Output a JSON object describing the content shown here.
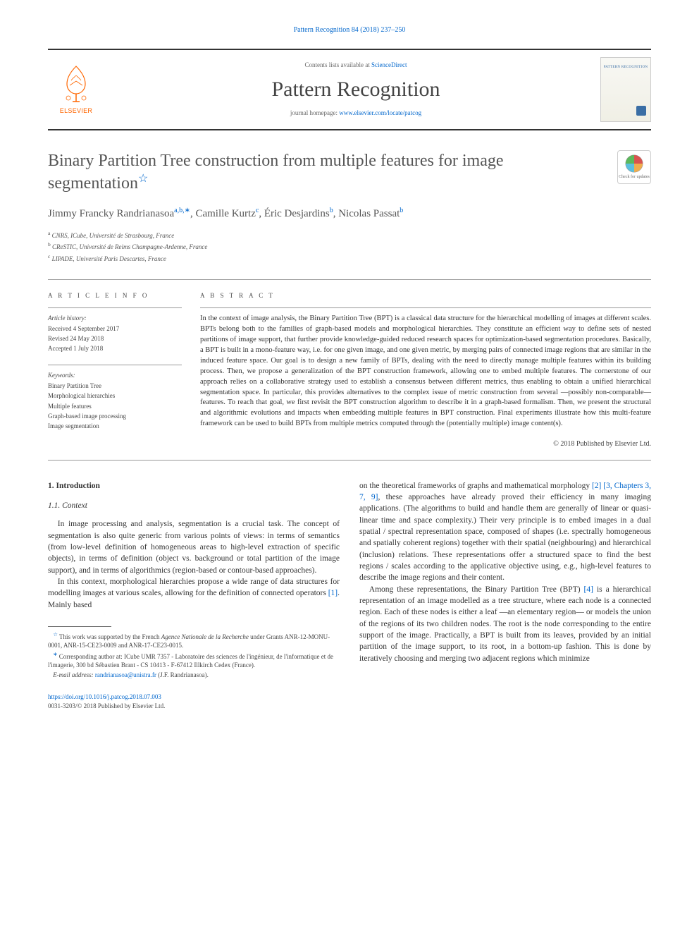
{
  "header": {
    "citation": "Pattern Recognition 84 (2018) 237–250",
    "contents_prefix": "Contents lists available at ",
    "contents_link": "ScienceDirect",
    "journal_name": "Pattern Recognition",
    "homepage_prefix": "journal homepage: ",
    "homepage_link": "www.elsevier.com/locate/patcog",
    "elsevier_label": "ELSEVIER",
    "cover_title": "PATTERN RECOGNITION"
  },
  "article": {
    "title": "Binary Partition Tree construction from multiple features for image segmentation",
    "check_updates": "Check for updates"
  },
  "authors_line": "Jimmy Francky Randrianasoa",
  "authors_sup1": "a,b,∗",
  "authors_name2": ", Camille Kurtz",
  "authors_sup2": "c",
  "authors_name3": ", Éric Desjardins",
  "authors_sup3": "b",
  "authors_name4": ", Nicolas Passat",
  "authors_sup4": "b",
  "affiliations": {
    "a_sup": "a",
    "a_text": " CNRS, ICube, Université de Strasbourg, France",
    "b_sup": "b",
    "b_text": " CReSTIC, Université de Reims Champagne-Ardenne, France",
    "c_sup": "c",
    "c_text": " LIPADE, Université Paris Descartes, France"
  },
  "info": {
    "article_info_label": "A R T I C L E   I N F O",
    "history_label": "Article history:",
    "received": "Received 4 September 2017",
    "revised": "Revised 24 May 2018",
    "accepted": "Accepted 1 July 2018",
    "keywords_label": "Keywords:",
    "keywords": [
      "Binary Partition Tree",
      "Morphological hierarchies",
      "Multiple features",
      "Graph-based image processing",
      "Image segmentation"
    ]
  },
  "abstract": {
    "label": "A B S T R A C T",
    "text": "In the context of image analysis, the Binary Partition Tree (BPT) is a classical data structure for the hierarchical modelling of images at different scales. BPTs belong both to the families of graph-based models and morphological hierarchies. They constitute an efficient way to define sets of nested partitions of image support, that further provide knowledge-guided reduced research spaces for optimization-based segmentation procedures. Basically, a BPT is built in a mono-feature way, i.e. for one given image, and one given metric, by merging pairs of connected image regions that are similar in the induced feature space. Our goal is to design a new family of BPTs, dealing with the need to directly manage multiple features within its building process. Then, we propose a generalization of the BPT construction framework, allowing one to embed multiple features. The cornerstone of our approach relies on a collaborative strategy used to establish a consensus between different metrics, thus enabling to obtain a unified hierarchical segmentation space. In particular, this provides alternatives to the complex issue of metric construction from several —possibly non-comparable— features. To reach that goal, we first revisit the BPT construction algorithm to describe it in a graph-based formalism. Then, we present the structural and algorithmic evolutions and impacts when embedding multiple features in BPT construction. Final experiments illustrate how this multi-feature framework can be used to build BPTs from multiple metrics computed through the (potentially multiple) image content(s).",
    "copyright": "© 2018 Published by Elsevier Ltd."
  },
  "body": {
    "sec1": "1. Introduction",
    "sec1_1": "1.1. Context",
    "p1": "In image processing and analysis, segmentation is a crucial task. The concept of segmentation is also quite generic from various points of views: in terms of semantics (from low-level definition of homogeneous areas to high-level extraction of specific objects), in terms of definition (object vs. background or total partition of the image support), and in terms of algorithmics (region-based or contour-based approaches).",
    "p2_a": "In this context, morphological hierarchies propose a wide range of data structures for modelling images at various scales, allowing for the definition of connected operators ",
    "ref1": "[1]",
    "p2_b": ". Mainly based",
    "p3_a": "on the theoretical frameworks of graphs and mathematical morphology ",
    "ref2": "[2]",
    "p3_mid": " ",
    "ref3": "[3, Chapters 3, 7, 9]",
    "p3_b": ", these approaches have already proved their efficiency in many imaging applications. (The algorithms to build and handle them are generally of linear or quasi-linear time and space complexity.) Their very principle is to embed images in a dual spatial / spectral representation space, composed of shapes (i.e. spectrally homogeneous and spatially coherent regions) together with their spatial (neighbouring) and hierarchical (inclusion) relations. These representations offer a structured space to find the best regions / scales according to the applicative objective using, e.g., high-level features to describe the image regions and their content.",
    "p4_a": "Among these representations, the Binary Partition Tree (BPT) ",
    "ref4": "[4]",
    "p4_b": " is a hierarchical representation of an image modelled as a tree structure, where each node is a connected region. Each of these nodes is either a leaf —an elementary region— or models the union of the regions of its two children nodes. The root is the node corresponding to the entire support of the image. Practically, a BPT is built from its leaves, provided by an initial partition of the image support, to its root, in a bottom-up fashion. This is done by iteratively choosing and merging two adjacent regions which minimize"
  },
  "footnotes": {
    "fn1_star": "☆",
    "fn1_a": " This work was supported by the French ",
    "fn1_b": "Agence Nationale de la Recherche",
    "fn1_c": " under Grants ANR-12-MONU-0001, ANR-15-CE23-0009 and ANR-17-CE23-0015.",
    "fn2_star": "∗",
    "fn2": " Corresponding author at: ICube UMR 7357 - Laboratoire des sciences de l'ingénieur, de l'informatique et de l'imagerie, 300 bd Sébastien Brant - CS 10413 - F-67412 Illkirch Cedex (France).",
    "fn3_label": "E-mail address: ",
    "fn3_email": "randrianasoa@unistra.fr",
    "fn3_tail": " (J.F. Randrianasoa)."
  },
  "footer": {
    "doi": "https://doi.org/10.1016/j.patcog.2018.07.003",
    "line2": "0031-3203/© 2018 Published by Elsevier Ltd."
  }
}
